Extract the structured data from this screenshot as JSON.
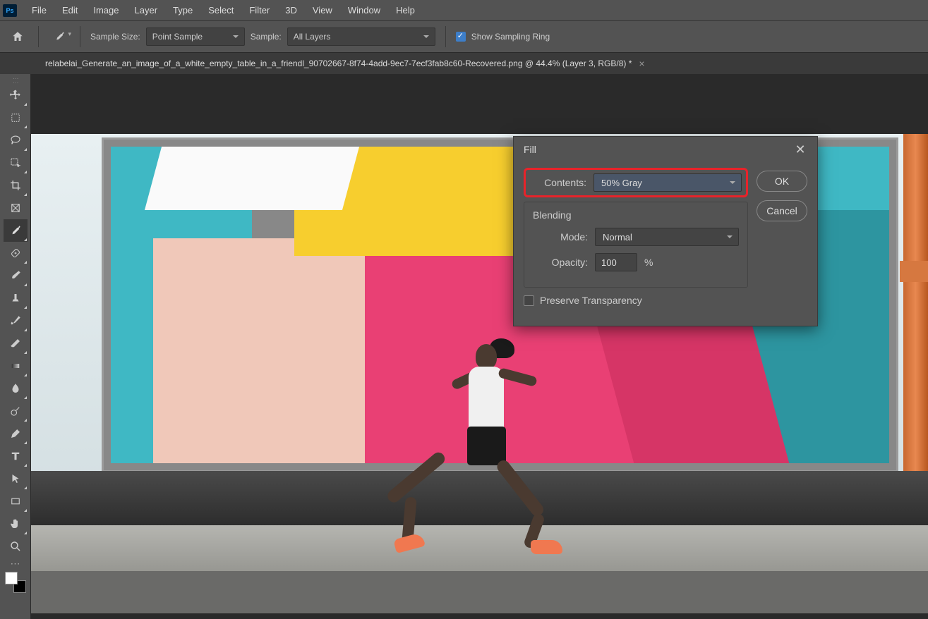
{
  "app": {
    "logo": "Ps"
  },
  "menu": {
    "items": [
      "File",
      "Edit",
      "Image",
      "Layer",
      "Type",
      "Select",
      "Filter",
      "3D",
      "View",
      "Window",
      "Help"
    ]
  },
  "options": {
    "sample_size_label": "Sample Size:",
    "sample_size_value": "Point Sample",
    "sample_label": "Sample:",
    "sample_value": "All Layers",
    "show_ring_label": "Show Sampling Ring"
  },
  "document": {
    "tab_title": "relabelai_Generate_an_image_of_a_white_empty_table_in_a_friendl_90702667-8f74-4add-9ec7-7ecf3fab8c60-Recovered.png @ 44.4% (Layer 3, RGB/8) *"
  },
  "tools": [
    "move",
    "marquee",
    "lasso",
    "quick-select",
    "crop",
    "frame",
    "eyedropper",
    "healing",
    "brush",
    "clone",
    "history-brush",
    "eraser",
    "gradient",
    "blur",
    "dodge",
    "pen",
    "type",
    "path-select",
    "rectangle",
    "hand",
    "zoom"
  ],
  "dialog": {
    "title": "Fill",
    "contents_label": "Contents:",
    "contents_value": "50% Gray",
    "blending_label": "Blending",
    "mode_label": "Mode:",
    "mode_value": "Normal",
    "opacity_label": "Opacity:",
    "opacity_value": "100",
    "opacity_unit": "%",
    "preserve_label": "Preserve Transparency",
    "ok_label": "OK",
    "cancel_label": "Cancel"
  }
}
